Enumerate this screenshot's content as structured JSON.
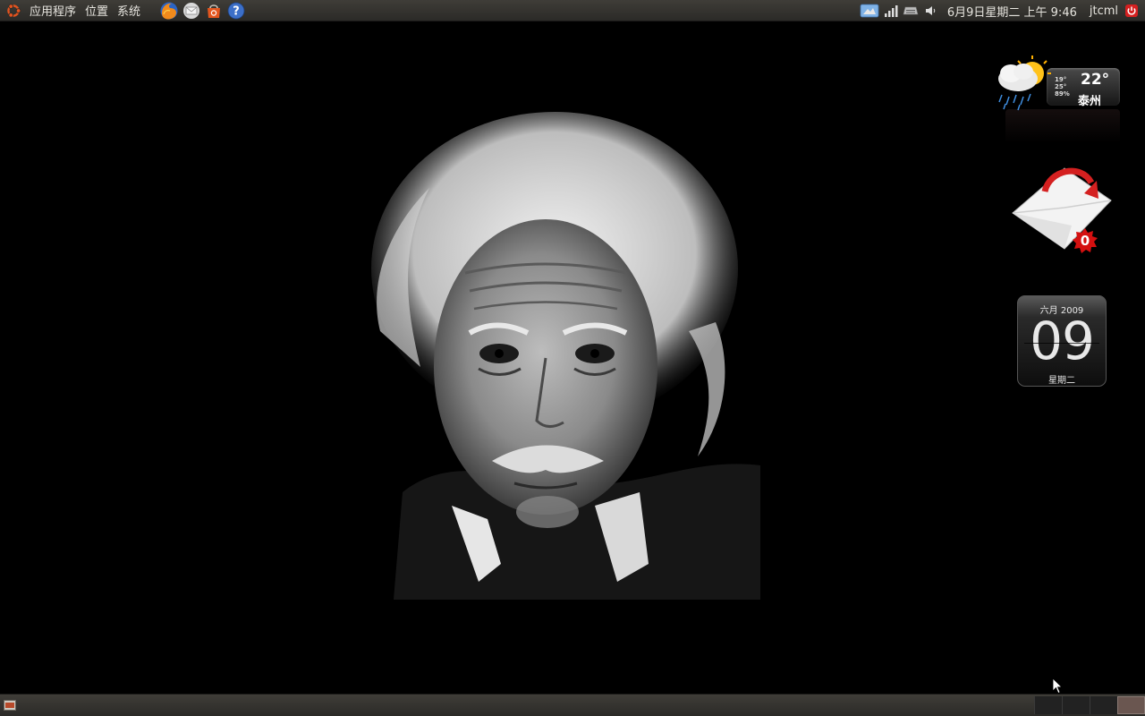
{
  "top_panel": {
    "menus": [
      "应用程序",
      "位置",
      "系统"
    ],
    "launchers": [
      {
        "name": "firefox-icon"
      },
      {
        "name": "mail-client-icon"
      },
      {
        "name": "software-store-icon"
      },
      {
        "name": "help-icon"
      }
    ],
    "tray": {
      "clock": "6月9日星期二 上午 9:46",
      "username": "jtcml"
    }
  },
  "widgets": {
    "weather": {
      "temperature": "22°",
      "city": "泰州",
      "low": "19°",
      "high": "25°",
      "humidity": "89%"
    },
    "mail": {
      "unread_count": "0"
    },
    "calendar": {
      "month_year": "六月 2009",
      "day": "09",
      "weekday": "星期二"
    }
  },
  "colors": {
    "panel": "#3c3b37",
    "desktop": "#000000",
    "mail_badge": "#d41010"
  }
}
